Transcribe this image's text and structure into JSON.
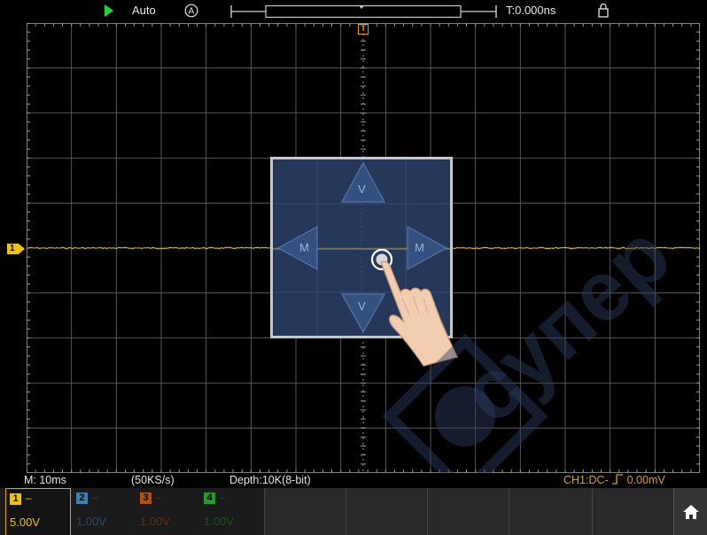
{
  "topbar": {
    "run_state_icon": "play-icon",
    "trigger_mode": "Auto",
    "auto_icon": "circled-a-icon",
    "trigger_time": "T:0.000ns",
    "lock_icon": "lock-icon"
  },
  "plot": {
    "trigger_marker": "T",
    "channel_marker": "1",
    "trace_color": "#e0c000",
    "grid_color": "#6b6b6b"
  },
  "overlay": {
    "up_label": "V",
    "down_label": "V",
    "left_label": "M",
    "right_label": "M",
    "hand_icon": "touch-hand-icon"
  },
  "info": {
    "timebase": "M: 10ms",
    "sample_rate": "(50KS/s)",
    "depth": "Depth:10K(8-bit)",
    "trigger_info": "CH1:DC-",
    "trigger_level": "0.00mV",
    "trigger_color": "#e0a500"
  },
  "channels": [
    {
      "id": "1",
      "dash": "–",
      "scale": "5.00V",
      "color": "#f2c400",
      "text_color": "#f2c400"
    },
    {
      "id": "2",
      "dash": "–",
      "scale": "1.00V",
      "color": "#4aa0d8",
      "text_color": "#2a3f55"
    },
    {
      "id": "3",
      "dash": "–",
      "scale": "1.00V",
      "color": "#e0601f",
      "text_color": "#5a2c10"
    },
    {
      "id": "4",
      "dash": "–",
      "scale": "1.00V",
      "color": "#39c039",
      "text_color": "#1d4a1d"
    }
  ],
  "home_icon": "home-icon",
  "watermark_text": "супер"
}
